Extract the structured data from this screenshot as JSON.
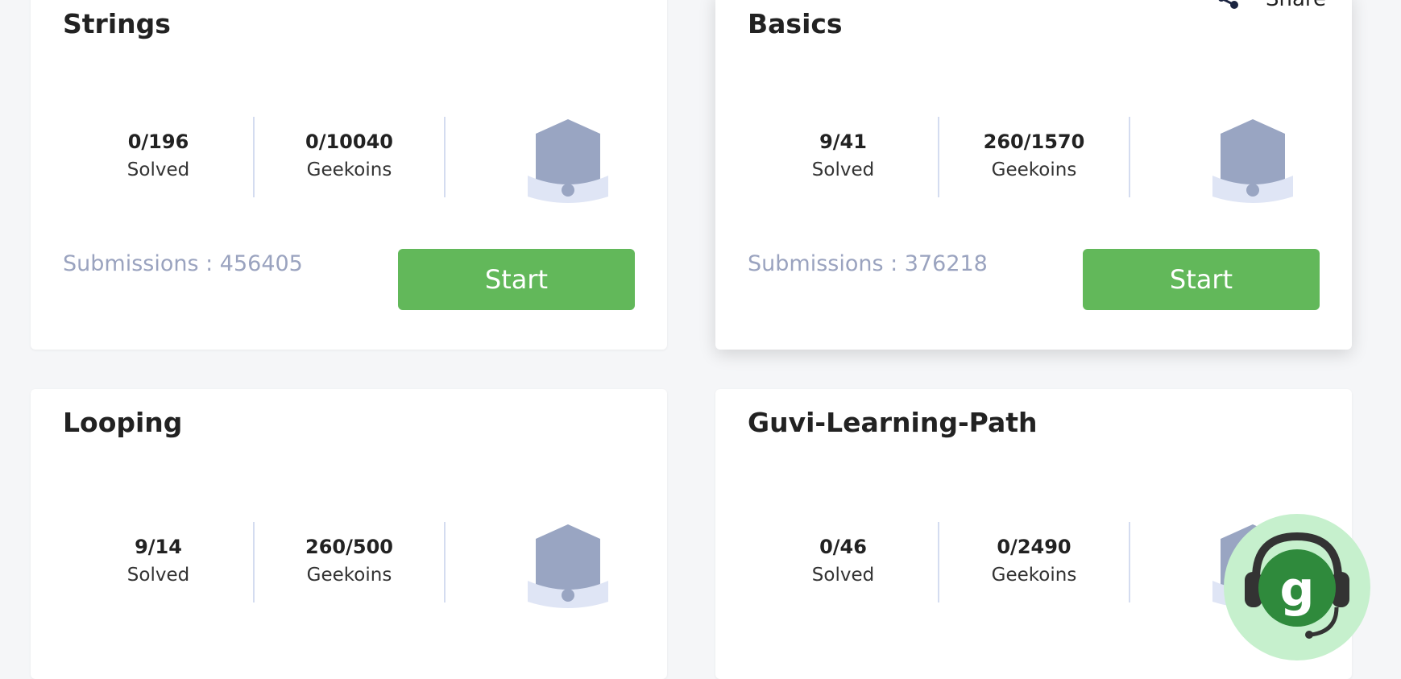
{
  "share_label": "Share",
  "cards": [
    {
      "title": "Strings",
      "solved": "0/196",
      "solved_label": "Solved",
      "geekoins": "0/10040",
      "geekoins_label": "Geekoins",
      "submissions": "Submissions : 456405",
      "start_label": "Start"
    },
    {
      "title": "Basics",
      "solved": "9/41",
      "solved_label": "Solved",
      "geekoins": "260/1570",
      "geekoins_label": "Geekoins",
      "submissions": "Submissions : 376218",
      "start_label": "Start"
    },
    {
      "title": "Looping",
      "solved": "9/14",
      "solved_label": "Solved",
      "geekoins": "260/500",
      "geekoins_label": "Geekoins"
    },
    {
      "title": "Guvi-Learning-Path",
      "solved": "0/46",
      "solved_label": "Solved",
      "geekoins": "0/2490",
      "geekoins_label": "Geekoins"
    }
  ],
  "colors": {
    "start_button": "#62b85a",
    "badge": "#99a5c2",
    "ribbon": "#dfe5f5",
    "divider": "#d4dcf0",
    "support_bg": "#c6f0cd"
  },
  "icons": {
    "share": "share-icon",
    "badge": "badge-icon",
    "support": "headset-support-icon"
  }
}
